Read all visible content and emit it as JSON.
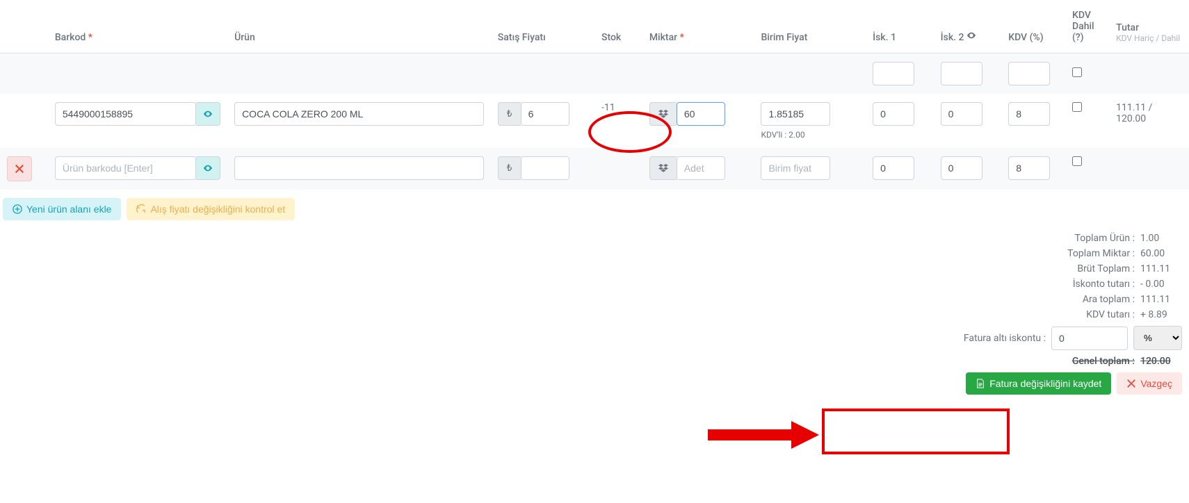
{
  "headers": {
    "barkod": "Barkod",
    "urun": "Ürün",
    "satis": "Satış Fiyatı",
    "stok": "Stok",
    "miktar": "Miktar",
    "birim": "Birim Fiyat",
    "isk1": "İsk. 1",
    "isk2": "İsk. 2",
    "kdv": "KDV (%)",
    "kdvDahil": "KDV Dahil (?)",
    "tutar": "Tutar",
    "tutarSub": "KDV Hariç / Dahil"
  },
  "row": {
    "barkod": "5449000158895",
    "urun": "COCA COLA ZERO 200 ML",
    "satis": "6",
    "stok": "-11",
    "miktar": "60",
    "birim": "1.85185",
    "kdvli": "KDV'li : 2.00",
    "isk1": "0",
    "isk2": "0",
    "kdv": "8",
    "tutar": "111.11 / 120.00"
  },
  "newRow": {
    "barkodPlaceholder": "Ürün barkodu [Enter]",
    "miktarPlaceholder": "Adet",
    "birimPlaceholder": "Birim fiyat",
    "isk1": "0",
    "isk2": "0",
    "kdv": "8"
  },
  "buttons": {
    "yeniUrun": "Yeni ürün alanı ekle",
    "alisKontrol": "Alış fiyatı değişikliğini kontrol et",
    "kaydet": "Fatura değişikliğini kaydet",
    "vazgec": "Vazgeç"
  },
  "summary": {
    "toplamUrunLabel": "Toplam Ürün :",
    "toplamUrun": "1.00",
    "toplamMiktarLabel": "Toplam Miktar :",
    "toplamMiktar": "60.00",
    "brutLabel": "Brüt Toplam :",
    "brut": "111.11",
    "iskontoLabel": "İskonto tutarı :",
    "iskonto": "- 0.00",
    "araLabel": "Ara toplam :",
    "ara": "111.11",
    "kdvLabel": "KDV tutarı :",
    "kdv": "+ 8.89",
    "faturaAltiLabel": "Fatura altı iskontu :",
    "faturaAlti": "0",
    "faturaAltiUnit": "%",
    "genelLabel": "Genel toplam :",
    "genel": "120.00"
  },
  "currencySymbol": "₺"
}
